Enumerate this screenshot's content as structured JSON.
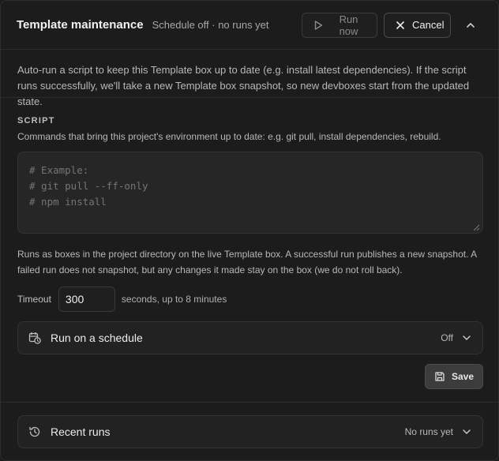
{
  "header": {
    "title": "Template maintenance",
    "subtitle": "Schedule off · no runs yet",
    "run_now_label": "Run now",
    "cancel_label": "Cancel"
  },
  "intro": "Auto-run a script to keep this Template box up to date (e.g. install latest dependencies). If the script runs successfully, we'll take a new Template box snapshot, so new devboxes start from the updated state.",
  "script": {
    "section_label": "SCRIPT",
    "description": "Commands that bring this project's environment up to date: e.g. git pull, install dependencies, rebuild.",
    "placeholder": "# Example:\n# git pull --ff-only\n# npm install",
    "note": "Runs as boxes in the project directory on the live Template box. A successful run publishes a new snapshot. A failed run does not snapshot, but any changes it made stay on the box (we do not roll back)."
  },
  "timeout": {
    "label": "Timeout",
    "value": "300",
    "suffix": "seconds, up to 8 minutes"
  },
  "schedule": {
    "label": "Run on a schedule",
    "status": "Off"
  },
  "save_label": "Save",
  "recent_runs": {
    "label": "Recent runs",
    "status": "No runs yet"
  },
  "icons": {
    "run_now": "play-icon",
    "cancel": "close-icon",
    "collapse": "chevron-up-icon",
    "schedule": "calendar-clock-icon",
    "save": "save-icon",
    "recent_runs": "history-icon"
  }
}
